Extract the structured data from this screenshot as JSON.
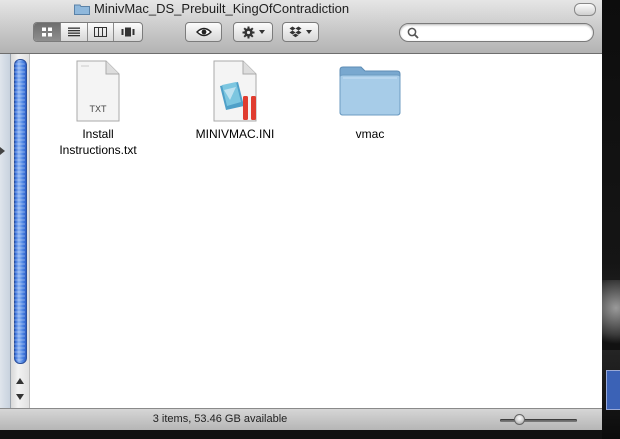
{
  "window": {
    "title": "MinivMac_DS_Prebuilt_KingOfContradiction"
  },
  "toolbar": {
    "view_modes": [
      "icon-view",
      "list-view",
      "column-view",
      "cover-flow-view"
    ],
    "active_view": "icon-view",
    "buttons": [
      "quick-look",
      "action",
      "dropbox"
    ],
    "search": {
      "placeholder": "",
      "value": ""
    }
  },
  "files": [
    {
      "name": "Install\nInstructions.txt",
      "kind": "text-document",
      "badge": "TXT"
    },
    {
      "name": "MINIVMAC.INI",
      "kind": "ini-document"
    },
    {
      "name": "vmac",
      "kind": "folder"
    }
  ],
  "status": {
    "text": "3 items, 53.46 GB available"
  },
  "colors": {
    "scroll_thumb": "#4f86e3",
    "folder_blue": "#8fb8dc"
  }
}
